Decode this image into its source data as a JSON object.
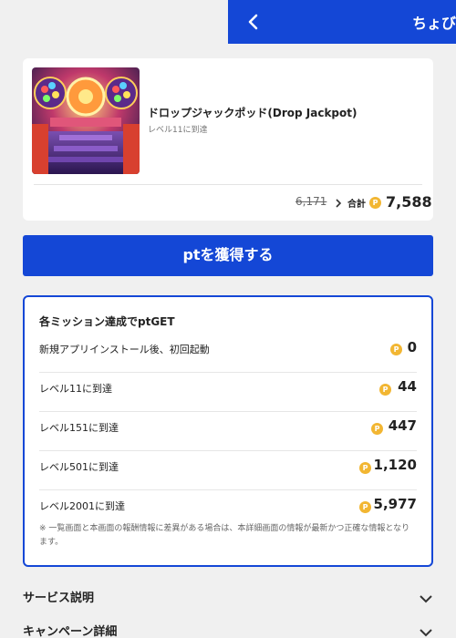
{
  "header": {
    "title": "ちょび"
  },
  "offer": {
    "game_title": "ドロップジャックポッド(Drop Jackpot)",
    "subtitle": "レベル11に到達",
    "old_points": "6,171",
    "total_label": "合計",
    "coin_symbol": "P",
    "total_points": "7,588"
  },
  "cta": {
    "label": "ptを獲得する"
  },
  "missions": {
    "heading": "各ミッション達成でptGET",
    "items": [
      {
        "label": "新規アプリインストール後、初回起動",
        "points": "0"
      },
      {
        "label": "レベル11に到達",
        "points": "44"
      },
      {
        "label": "レベル151に到達",
        "points": "447"
      },
      {
        "label": "レベル501に到達",
        "points": "1,120"
      },
      {
        "label": "レベル2001に到達",
        "points": "5,977"
      }
    ],
    "note": "※ 一覧画面と本画面の報酬情報に差異がある場合は、本詳細画面の情報が最新かつ正確な情報となります。"
  },
  "accordions": [
    {
      "label": "サービス説明"
    },
    {
      "label": "キャンペーン詳細"
    }
  ],
  "colors": {
    "primary": "#1447d6",
    "coin": "#f2b632",
    "background": "#f0f0f0"
  }
}
